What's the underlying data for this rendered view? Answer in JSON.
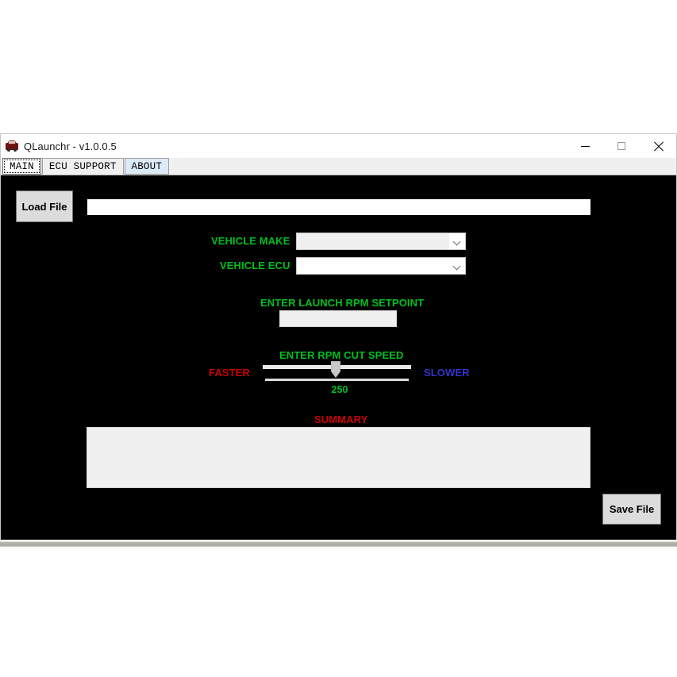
{
  "window": {
    "title": "QLaunchr - v1.0.0.5",
    "icon": "car-icon",
    "controls": {
      "minimize": "minimize-icon",
      "maximize": "maximize-icon",
      "close": "close-icon"
    }
  },
  "tabs": [
    {
      "label": "MAIN",
      "selected": true
    },
    {
      "label": "ECU SUPPORT",
      "selected": false
    },
    {
      "label": "ABOUT",
      "selected": false
    }
  ],
  "main": {
    "load_file_label": "Load File",
    "file_path_value": "",
    "vehicle_make": {
      "label": "VEHICLE MAKE",
      "value": "",
      "arrow": "chevron-down-icon"
    },
    "vehicle_ecu": {
      "label": "VEHICLE ECU",
      "value": "",
      "arrow": "chevron-down-icon"
    },
    "launch_rpm": {
      "label": "ENTER LAUNCH RPM SETPOINT",
      "value": ""
    },
    "rpm_cut": {
      "label": "ENTER RPM CUT SPEED",
      "faster_label": "FASTER",
      "slower_label": "SLOWER",
      "value": "250"
    },
    "summary": {
      "label": "SUMMARY",
      "text": ""
    },
    "save_file_label": "Save File"
  },
  "colors": {
    "green": "#00bf1f",
    "red": "#cc0000",
    "blue": "#3333cc",
    "client_background": "#000000"
  }
}
